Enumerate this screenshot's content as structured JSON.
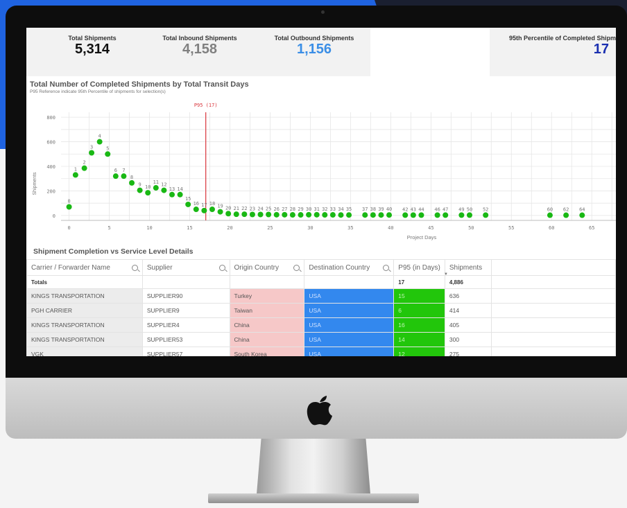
{
  "kpis": [
    {
      "label": "Total Shipments",
      "value": "5,314",
      "color": "#111111"
    },
    {
      "label": "Total Inbound Shipments",
      "value": "4,158",
      "color": "#808080"
    },
    {
      "label": "Total Outbound Shipments",
      "value": "1,156",
      "color": "#3a8ee6"
    },
    {
      "label": "95th Percentile of Completed Shipm",
      "value": "17",
      "color": "#1a2fb0"
    }
  ],
  "chart": {
    "title": "Total Number of Completed Shipments by Total Transit Days",
    "subtitle": "P95 Reference indicate 95th Percentile of shipments for selection(s)",
    "ref_label": "P95 (17)"
  },
  "chart_data": {
    "type": "scatter",
    "xlabel": "Project Days",
    "ylabel": "Shipments",
    "xlim": [
      -1,
      68
    ],
    "ylim": [
      -40,
      840
    ],
    "xticks": [
      0,
      5,
      10,
      15,
      20,
      25,
      30,
      35,
      40,
      45,
      50,
      55,
      60,
      65
    ],
    "yticks": [
      0,
      200,
      400,
      600,
      800
    ],
    "reference_x": 17,
    "point_color": "#19b814",
    "points": [
      {
        "x": 0,
        "y": 70,
        "label": "0"
      },
      {
        "x": 0.8,
        "y": 330,
        "label": "1"
      },
      {
        "x": 1.9,
        "y": 385,
        "label": "2"
      },
      {
        "x": 2.8,
        "y": 510,
        "label": "3"
      },
      {
        "x": 3.8,
        "y": 600,
        "label": "4"
      },
      {
        "x": 4.8,
        "y": 500,
        "label": "5"
      },
      {
        "x": 5.8,
        "y": 320,
        "label": "6"
      },
      {
        "x": 6.8,
        "y": 320,
        "label": "7"
      },
      {
        "x": 7.8,
        "y": 265,
        "label": "8"
      },
      {
        "x": 8.8,
        "y": 205,
        "label": "9"
      },
      {
        "x": 9.8,
        "y": 185,
        "label": "10"
      },
      {
        "x": 10.8,
        "y": 225,
        "label": "11"
      },
      {
        "x": 11.8,
        "y": 205,
        "label": "12"
      },
      {
        "x": 12.8,
        "y": 170,
        "label": "13"
      },
      {
        "x": 13.8,
        "y": 170,
        "label": "14"
      },
      {
        "x": 14.8,
        "y": 90,
        "label": "15"
      },
      {
        "x": 15.8,
        "y": 50,
        "label": "16"
      },
      {
        "x": 16.8,
        "y": 40,
        "label": "17"
      },
      {
        "x": 17.8,
        "y": 50,
        "label": "18"
      },
      {
        "x": 18.8,
        "y": 30,
        "label": "19"
      },
      {
        "x": 19.8,
        "y": 15,
        "label": "20"
      },
      {
        "x": 20.8,
        "y": 10,
        "label": "21"
      },
      {
        "x": 21.8,
        "y": 10,
        "label": "22"
      },
      {
        "x": 22.8,
        "y": 8,
        "label": "23"
      },
      {
        "x": 23.8,
        "y": 8,
        "label": "24"
      },
      {
        "x": 24.8,
        "y": 8,
        "label": "25"
      },
      {
        "x": 25.8,
        "y": 6,
        "label": "26"
      },
      {
        "x": 26.8,
        "y": 6,
        "label": "27"
      },
      {
        "x": 27.8,
        "y": 5,
        "label": "28"
      },
      {
        "x": 28.8,
        "y": 5,
        "label": "29"
      },
      {
        "x": 29.8,
        "y": 6,
        "label": "30"
      },
      {
        "x": 30.8,
        "y": 6,
        "label": "31"
      },
      {
        "x": 31.8,
        "y": 5,
        "label": "32"
      },
      {
        "x": 32.8,
        "y": 5,
        "label": "33"
      },
      {
        "x": 33.8,
        "y": 4,
        "label": "34"
      },
      {
        "x": 34.8,
        "y": 4,
        "label": "35"
      },
      {
        "x": 36.8,
        "y": 4,
        "label": "37"
      },
      {
        "x": 37.8,
        "y": 4,
        "label": "38"
      },
      {
        "x": 38.8,
        "y": 4,
        "label": "39"
      },
      {
        "x": 39.8,
        "y": 4,
        "label": "40"
      },
      {
        "x": 41.8,
        "y": 3,
        "label": "42"
      },
      {
        "x": 42.8,
        "y": 3,
        "label": "43"
      },
      {
        "x": 43.8,
        "y": 3,
        "label": "44"
      },
      {
        "x": 45.8,
        "y": 3,
        "label": "46"
      },
      {
        "x": 46.8,
        "y": 3,
        "label": "47"
      },
      {
        "x": 48.8,
        "y": 3,
        "label": "49"
      },
      {
        "x": 49.8,
        "y": 3,
        "label": "50"
      },
      {
        "x": 51.8,
        "y": 3,
        "label": "52"
      },
      {
        "x": 59.8,
        "y": 2,
        "label": "60"
      },
      {
        "x": 61.8,
        "y": 2,
        "label": "62"
      },
      {
        "x": 63.8,
        "y": 2,
        "label": "64"
      }
    ]
  },
  "table": {
    "title": "Shipment Completion vs Service Level Details",
    "columns": [
      "Carrier / Forwarder Name",
      "Supplier",
      "Origin Country",
      "Destination Country",
      "P95 (in Days)",
      "Shipments"
    ],
    "totals": {
      "label": "Totals",
      "p95": "17",
      "shipments": "4,886"
    },
    "rows": [
      {
        "carrier": "KINGS TRANSPORTATION",
        "supplier": "SUPPLIER90",
        "origin": "Turkey",
        "destination": "USA",
        "p95": "15",
        "shipments": "636"
      },
      {
        "carrier": "PGH CARRIER",
        "supplier": "SUPPLIER9",
        "origin": "Taiwan",
        "destination": "USA",
        "p95": "6",
        "shipments": "414"
      },
      {
        "carrier": "KINGS TRANSPORTATION",
        "supplier": "SUPPLIER4",
        "origin": "China",
        "destination": "USA",
        "p95": "16",
        "shipments": "405"
      },
      {
        "carrier": "KINGS TRANSPORTATION",
        "supplier": "SUPPLIER53",
        "origin": "China",
        "destination": "USA",
        "p95": "14",
        "shipments": "300"
      },
      {
        "carrier": "VGK",
        "supplier": "SUPPLIER57",
        "origin": "South Korea",
        "destination": "USA",
        "p95": "12",
        "shipments": "275"
      }
    ],
    "colors": {
      "origin": "#f6c8c8",
      "destination": "#3388ee",
      "p95": "#22c60b",
      "carrier": "#ececec"
    }
  }
}
